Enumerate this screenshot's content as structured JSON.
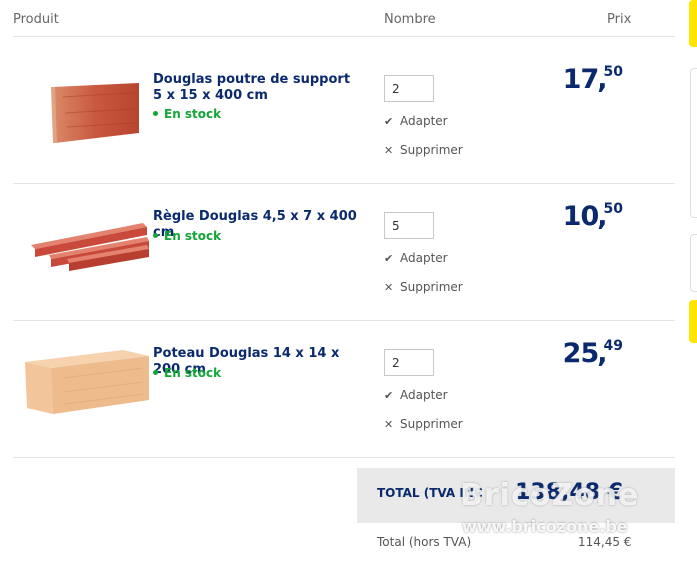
{
  "header": {
    "product": "Produit",
    "quantity": "Nombre",
    "price": "Prix"
  },
  "items": [
    {
      "name": "Douglas poutre de support 5 x 15 x 400 cm",
      "stock": "En stock",
      "quantity": "2",
      "adapt": "Adapter",
      "delete": "Supprimer",
      "price_int": "17",
      "price_comma": ",",
      "price_dec": "50"
    },
    {
      "name": "Règle Douglas 4,5 x 7 x 400 cm",
      "stock": "En stock",
      "quantity": "5",
      "adapt": "Adapter",
      "delete": "Supprimer",
      "price_int": "10",
      "price_comma": ",",
      "price_dec": "50"
    },
    {
      "name": "Poteau Douglas 14 x 14 x 200 cm",
      "stock": "En stock",
      "quantity": "2",
      "adapt": "Adapter",
      "delete": "Supprimer",
      "price_int": "25",
      "price_comma": ",",
      "price_dec": "49"
    }
  ],
  "totals": {
    "total_label": "TOTAL (TVA INC",
    "total_value": "138,48 €",
    "subtotal_label": "Total (hors TVA)",
    "subtotal_value": "114,45 €"
  },
  "watermark": {
    "brand": "BricoZone",
    "url": "www.bricozone.be"
  },
  "colors": {
    "brand_blue": "#0b2a6e",
    "stock_green": "#13a538",
    "accent_yellow": "#ffe500"
  }
}
